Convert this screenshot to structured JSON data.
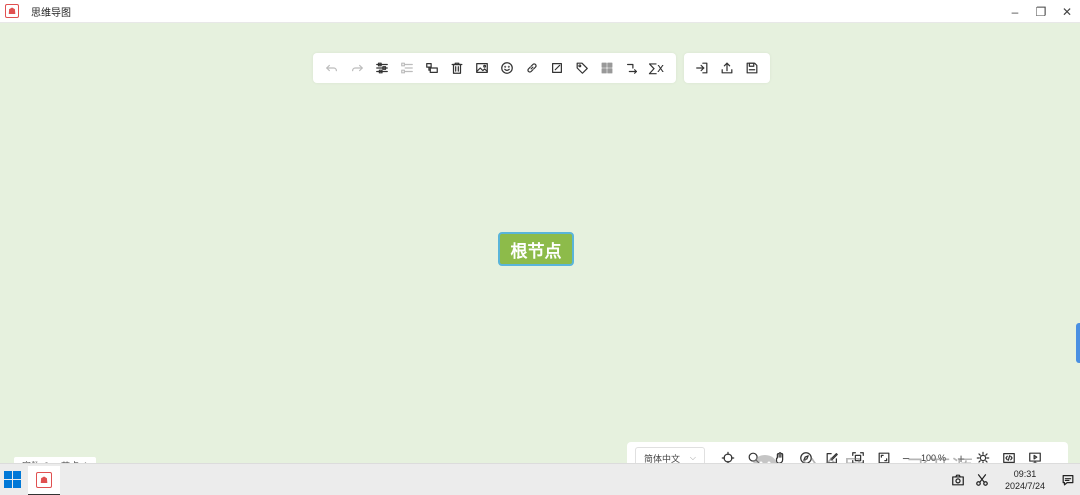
{
  "window": {
    "title": "思维导图",
    "app_icon": "mindmap-app-icon",
    "controls": [
      "minimize-icon",
      "restore-icon",
      "close-icon"
    ]
  },
  "toolbar": {
    "main_buttons": [
      {
        "name": "undo-button",
        "icon": "undo-icon",
        "enabled": false
      },
      {
        "name": "redo-button",
        "icon": "redo-icon",
        "enabled": false
      },
      {
        "name": "add-child-node-button",
        "icon": "add-child-icon",
        "enabled": true
      },
      {
        "name": "add-sibling-node-button",
        "icon": "add-sibling-icon",
        "enabled": false
      },
      {
        "name": "add-parent-node-button",
        "icon": "add-parent-icon",
        "enabled": true
      },
      {
        "name": "delete-node-button",
        "icon": "trash-icon",
        "enabled": true
      },
      {
        "name": "image-button",
        "icon": "image-icon",
        "enabled": true
      },
      {
        "name": "icon-button",
        "icon": "smiley-icon",
        "enabled": true
      },
      {
        "name": "hyperlink-button",
        "icon": "link-icon",
        "enabled": true
      },
      {
        "name": "note-button",
        "icon": "note-icon",
        "enabled": true
      },
      {
        "name": "tag-button",
        "icon": "tag-icon",
        "enabled": true
      },
      {
        "name": "summary-button",
        "icon": "grid-icon",
        "enabled": true
      },
      {
        "name": "associative-line-button",
        "icon": "relation-icon",
        "enabled": true
      },
      {
        "name": "formula-button",
        "icon": "formula-icon",
        "enabled": true
      }
    ],
    "file_buttons": [
      {
        "name": "import-button",
        "icon": "import-icon"
      },
      {
        "name": "export-button",
        "icon": "export-icon"
      },
      {
        "name": "save-button",
        "icon": "save-icon"
      }
    ]
  },
  "mindmap": {
    "root_node_text": "根节点",
    "root_fill": "#8dbb4a",
    "root_border": "#5ab5d9"
  },
  "status": {
    "word_count_label": "字数",
    "word_count": "3",
    "node_count_label": "节点",
    "node_count": "1"
  },
  "bottom_bar": {
    "language": "简体中文",
    "zoom_value": "100",
    "zoom_unit": "%",
    "zoom_minus": "−",
    "zoom_plus": "+"
  },
  "watermark": {
    "text": "公众号 · 一飞开源"
  },
  "taskbar": {
    "time": "09:31",
    "date": "2024/7/24"
  },
  "colors": {
    "canvas_bg": "#e6f1de",
    "accent": "#4a90e2"
  }
}
